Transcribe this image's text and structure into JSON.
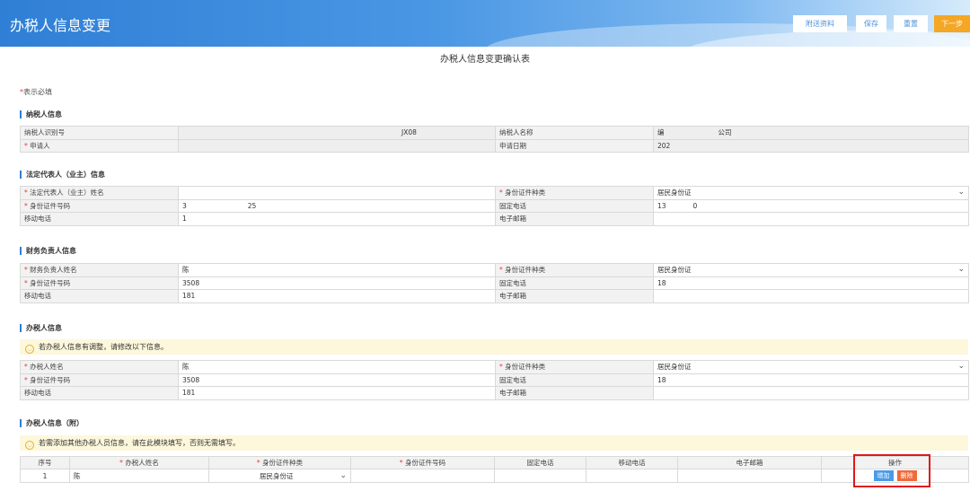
{
  "header": {
    "title": "办税人信息变更",
    "buttons": {
      "attach": "附送资料",
      "save": "保存",
      "reset": "重置",
      "next": "下一步"
    }
  },
  "page_title": "办税人信息变更确认表",
  "required_note": {
    "star": "*",
    "text": "表示必填"
  },
  "taxpayer": {
    "section": "纳税人信息",
    "tax_id_label": "纳税人识别号",
    "tax_id_value": "JX08",
    "name_label": "纳税人名称",
    "name_value_prefix": "编",
    "name_value_suffix": "公司",
    "applicant_label": "申请人",
    "applicant_value": "",
    "date_label": "申请日期",
    "date_value": "202"
  },
  "legal": {
    "section": "法定代表人（业主）信息",
    "name_label": "法定代表人（业主）姓名",
    "name_value": "",
    "idtype_label": "身份证件种类",
    "idtype_value": "居民身份证",
    "idno_label": "身份证件号码",
    "idno_prefix": "3",
    "idno_suffix": "25",
    "phone_label": "固定电话",
    "phone_prefix": "13",
    "phone_suffix": "0",
    "mobile_label": "移动电话",
    "mobile_value": "1",
    "email_label": "电子邮箱",
    "email_value": ""
  },
  "finance": {
    "section": "财务负责人信息",
    "name_label": "财务负责人姓名",
    "name_value": "陈",
    "idtype_label": "身份证件种类",
    "idtype_value": "居民身份证",
    "idno_label": "身份证件号码",
    "idno_value": "3508",
    "phone_label": "固定电话",
    "phone_value": "18",
    "mobile_label": "移动电话",
    "mobile_value": "181",
    "email_label": "电子邮箱",
    "email_value": ""
  },
  "taxagent": {
    "section": "办税人信息",
    "notice": "若办税人信息有调整，请修改以下信息。",
    "name_label": "办税人姓名",
    "name_value": "陈",
    "idtype_label": "身份证件种类",
    "idtype_value": "居民身份证",
    "idno_label": "身份证件号码",
    "idno_value": "3508",
    "phone_label": "固定电话",
    "phone_value": "18",
    "mobile_label": "移动电话",
    "mobile_value": "181",
    "email_label": "电子邮箱",
    "email_value": ""
  },
  "attached": {
    "section": "办税人信息（附）",
    "notice": "若需添加其他办税人员信息，请在此模块填写，否则无需填写。",
    "columns": [
      "序号",
      "办税人姓名",
      "身份证件种类",
      "身份证件号码",
      "固定电话",
      "移动电话",
      "电子邮箱",
      "操作"
    ],
    "row": {
      "index": "1",
      "name": "陈",
      "idtype": "居民身份证",
      "idno": "",
      "phone": "",
      "mobile": "",
      "email": ""
    },
    "add_label": "增加",
    "delete_label": "删除"
  }
}
